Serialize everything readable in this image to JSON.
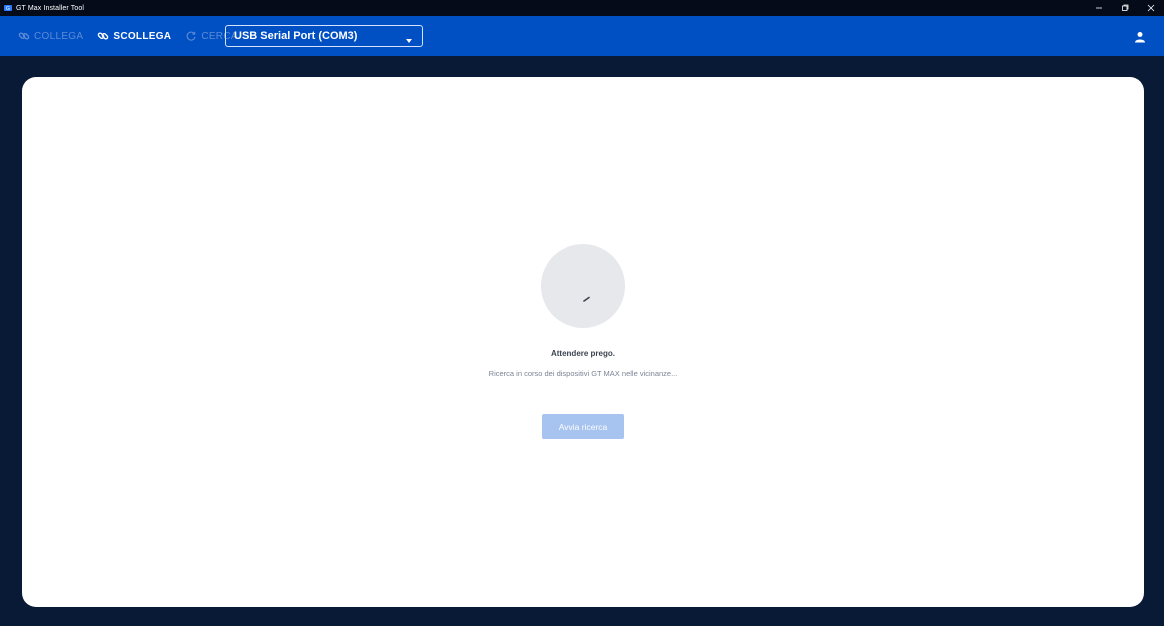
{
  "window": {
    "title": "GT Max Installer Tool"
  },
  "toolbar": {
    "connect_label": "COLLEGA",
    "disconnect_label": "SCOLLEGA",
    "search_label": "CERCA",
    "port_value": "USB Serial Port (COM3)"
  },
  "main": {
    "wait_title": "Attendere prego.",
    "wait_subtitle": "Ricerca in corso dei dispositivi GT MAX nelle vicinanze...",
    "start_button_label": "Avvia ricerca"
  },
  "colors": {
    "toolbar_bg": "#0050c4",
    "page_bg": "#081a36",
    "disabled_text": "#5c8bd6",
    "button_disabled_bg": "#a7c3ef"
  },
  "icons": {
    "app": "gt-logo-icon",
    "connect": "link-icon",
    "disconnect": "unlink-icon",
    "search": "refresh-icon",
    "dropdown": "caret-down-icon",
    "user": "user-icon",
    "minimize": "minimize-icon",
    "maximize": "restore-icon",
    "close": "close-icon"
  }
}
